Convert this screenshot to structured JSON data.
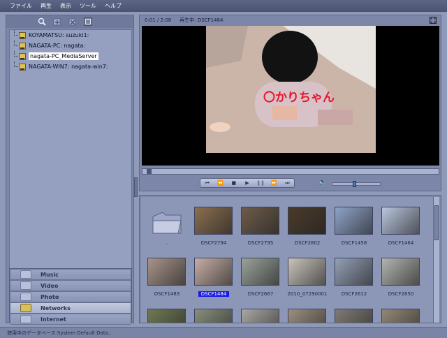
{
  "menu": [
    "ファイル",
    "再生",
    "表示",
    "ツール",
    "ヘルプ"
  ],
  "tree": [
    {
      "label": "KOYAMATSU: suzuki1:",
      "selected": false
    },
    {
      "label": "NAGATA-PC: nagata:",
      "selected": false
    },
    {
      "label": "nagata-PC_MediaServer",
      "selected": true
    },
    {
      "label": "NAGATA-WIN7: nagata-win7:",
      "selected": false
    }
  ],
  "categories": [
    {
      "label": "Music",
      "active": false
    },
    {
      "label": "Video",
      "active": false
    },
    {
      "label": "Photo",
      "active": false
    },
    {
      "label": "Networks",
      "active": true
    },
    {
      "label": "Internet",
      "active": false
    }
  ],
  "player": {
    "time": "0:01 / 2:08",
    "now_playing": "再生中: DSCF1484",
    "overlay_caption": "〇かりちゃん",
    "volume_level": 0.45,
    "progress": 0.01
  },
  "thumbnails": [
    {
      "caption": "..",
      "kind": "folder"
    },
    {
      "caption": "DSCF2794",
      "color": "#8b6f4f"
    },
    {
      "caption": "DSCF2795",
      "color": "#6e5c4a"
    },
    {
      "caption": "DSCF2802",
      "color": "#4a3b2a"
    },
    {
      "caption": "DSCF1458",
      "color": "#8fa3c8"
    },
    {
      "caption": "DSCF1464",
      "color": "#b9c6de"
    },
    {
      "caption": "DSCF1483",
      "color": "#a8948a"
    },
    {
      "caption": "DSCF1484",
      "color": "#c7aea6",
      "selected": true
    },
    {
      "caption": "DSCF2667",
      "color": "#9aa39a"
    },
    {
      "caption": "2010_07290001",
      "color": "#c9c4bb"
    },
    {
      "caption": "DSCF2612",
      "color": "#94a0b5"
    },
    {
      "caption": "DSCF2650",
      "color": "#b1b4b0"
    },
    {
      "caption": "",
      "color": "#6f7a52"
    },
    {
      "caption": "",
      "color": "#87907a"
    },
    {
      "caption": "",
      "color": "#a9a8a2"
    },
    {
      "caption": "",
      "color": "#9b8f7f"
    },
    {
      "caption": "",
      "color": "#807a74"
    },
    {
      "caption": "",
      "color": "#938877"
    }
  ],
  "status": "使用中のデータベース:System Default Data...",
  "icons": {
    "toolbar": [
      "search-icon",
      "add-icon",
      "delete-icon",
      "properties-icon"
    ],
    "fullscreen": "fullscreen-icon",
    "volume": "speaker-icon"
  }
}
